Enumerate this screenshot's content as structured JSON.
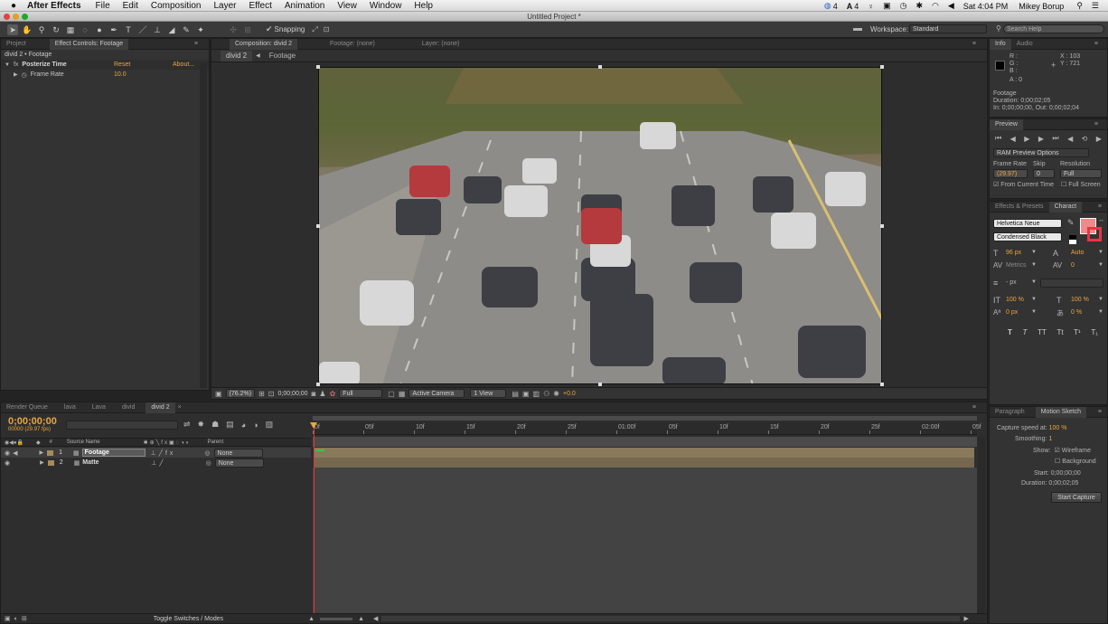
{
  "menubar": {
    "apple": "",
    "app_name": "After Effects",
    "items": [
      "File",
      "Edit",
      "Composition",
      "Layer",
      "Effect",
      "Animation",
      "View",
      "Window",
      "Help"
    ],
    "status": {
      "indicator1": "4",
      "indicator2": "4",
      "clock": "Sat 4:04 PM",
      "user": "Mikey Borup"
    }
  },
  "window_title": "Untitled Project *",
  "toolbar": {
    "snapping_label": "Snapping",
    "workspace_label": "Workspace:",
    "workspace_value": "Standard",
    "search_placeholder": "Search Help"
  },
  "project_panel": {
    "tabs": [
      "Project",
      "Effect Controls: Footage"
    ],
    "breadcrumb": "divid 2 • Footage",
    "effect_name": "Posterize Time",
    "reset_label": "Reset",
    "about_label": "About...",
    "param_name": "Frame Rate",
    "param_value": "10.0"
  },
  "composition_panel": {
    "tabs": [
      "Composition: divid 2",
      "Footage: (none)",
      "Layer: (none)"
    ],
    "flow_tabs": [
      "divid 2",
      "Footage"
    ],
    "footer": {
      "zoom": "(76.2%)",
      "timecode": "0;00;00;00",
      "resolution": "Full",
      "camera": "Active Camera",
      "view": "1 View",
      "exposure": "+0.0"
    }
  },
  "info_panel": {
    "tabs": [
      "Info",
      "Audio"
    ],
    "r": "R :",
    "g": "G :",
    "b": "B :",
    "a": "A : 0",
    "x": "X : 103",
    "y": "Y : 721",
    "name": "Footage",
    "duration": "Duration: 0;00;02;05",
    "inout": "In: 0;00;00;00, Out: 0;00;02;04"
  },
  "preview_panel": {
    "tab": "Preview",
    "ram_options": "RAM Preview Options",
    "frame_rate_label": "Frame Rate",
    "skip_label": "Skip",
    "resolution_label": "Resolution",
    "frame_rate_value": "(29.97)",
    "skip_value": "0",
    "resolution_value": "Full",
    "from_current": "From Current Time",
    "full_screen": "Full Screen"
  },
  "character_panel": {
    "tabs": [
      "Effects & Presets",
      "Charact"
    ],
    "font": "Helvetica Neue",
    "style": "Condensed Black",
    "size": "96 px",
    "leading": "Auto",
    "kerning": "Metrics",
    "tracking": "0",
    "stroke": "- px",
    "vscale": "100 %",
    "hscale": "100 %",
    "baseline": "0 px",
    "tsume": "0 %",
    "fill_color": "#f08a8a",
    "styles": [
      "T",
      "T",
      "TT",
      "Tt",
      "T¹",
      "T₁"
    ]
  },
  "motion_sketch": {
    "tabs": [
      "Paragraph",
      "Motion Sketch"
    ],
    "capture_label": "Capture speed at:",
    "capture_value": "100 %",
    "smoothing_label": "Smoothing:",
    "smoothing_value": "1",
    "show_label": "Show:",
    "wireframe": "Wireframe",
    "background": "Background",
    "start_label": "Start:",
    "start_value": "0;00;00;00",
    "duration_label": "Duration:",
    "duration_value": "0;00;02;05",
    "button": "Start Capture"
  },
  "timeline": {
    "tabs": [
      "Render Queue",
      "lava",
      "Lava",
      "divid",
      "divid 2"
    ],
    "timecode": "0;00;00;00",
    "frames": "00000 (29.97 fps)",
    "search_placeholder": "",
    "col_source": "Source Name",
    "col_parent": "Parent",
    "col_hash": "#",
    "layers": [
      {
        "num": "1",
        "name": "Footage",
        "parent": "None"
      },
      {
        "num": "2",
        "name": "Matte",
        "parent": "None"
      }
    ],
    "ruler": [
      "0f",
      "05f",
      "10f",
      "15f",
      "20f",
      "25f",
      "01:00f",
      "05f",
      "10f",
      "15f",
      "20f",
      "25f",
      "02:00f",
      "05f"
    ],
    "toggle_label": "Toggle Switches / Modes"
  }
}
